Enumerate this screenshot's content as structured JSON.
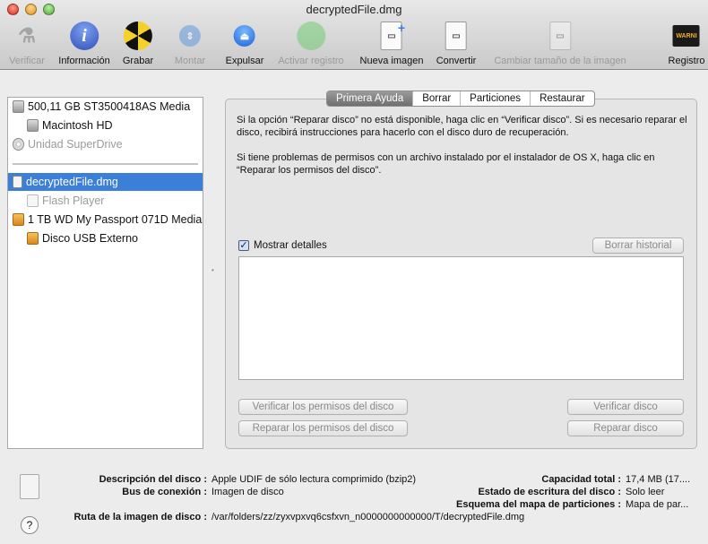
{
  "window": {
    "title": "decryptedFile.dmg"
  },
  "toolbar": [
    {
      "label": "Verificar",
      "icon": "microscope-icon",
      "enabled": false
    },
    {
      "label": "Información",
      "icon": "info-icon",
      "enabled": true
    },
    {
      "label": "Grabar",
      "icon": "burn-icon",
      "enabled": true
    },
    {
      "label": "Montar",
      "icon": "mount-icon",
      "enabled": false
    },
    {
      "label": "Expulsar",
      "icon": "eject-icon",
      "enabled": true
    },
    {
      "label": "Activar registro",
      "icon": "enable-journal-icon",
      "enabled": false
    },
    {
      "label": "Nueva imagen",
      "icon": "new-image-icon",
      "enabled": true
    },
    {
      "label": "Convertir",
      "icon": "convert-icon",
      "enabled": true
    },
    {
      "label": "Cambiar tamaño de la imagen",
      "icon": "resize-image-icon",
      "enabled": false
    },
    {
      "label": "Registro",
      "icon": "log-icon",
      "enabled": true,
      "glyph": "WARNI"
    }
  ],
  "sidebar": {
    "items": [
      {
        "label": "500,11 GB ST3500418AS Media"
      },
      {
        "label": "Macintosh HD"
      },
      {
        "label": "Unidad SuperDrive"
      },
      {
        "label": "decryptedFile.dmg"
      },
      {
        "label": "Flash Player"
      },
      {
        "label": "1 TB WD My Passport 071D Media"
      },
      {
        "label": "Disco USB Externo"
      }
    ]
  },
  "tabs": [
    "Primera Ayuda",
    "Borrar",
    "Particiones",
    "Restaurar"
  ],
  "first_aid": {
    "para1": "Si la opción “Reparar disco” no está disponible, haga clic en “Verificar disco”. Si es necesario reparar el disco, recibirá instrucciones para hacerlo con el disco duro de recuperación.",
    "para2": "Si tiene problemas de permisos con un archivo instalado por el instalador de OS X, haga clic en “Reparar los permisos del disco”.",
    "show_details": "Mostrar detalles",
    "show_details_checked": true,
    "clear_history": "Borrar historial",
    "verify_permissions": "Verificar los permisos del disco",
    "repair_permissions": "Reparar los permisos del disco",
    "verify_disk": "Verificar disco",
    "repair_disk": "Reparar disco"
  },
  "info": {
    "desc_label": "Descripción del disco :",
    "desc": "Apple UDIF de sólo lectura comprimido (bzip2)",
    "bus_label": "Bus de conexión :",
    "bus": "Imagen de disco",
    "path_label": "Ruta de la imagen de disco :",
    "path": "/var/folders/zz/zyxvpxvq6csfxvn_n0000000000000/T/decryptedFile.dmg",
    "cap_label": "Capacidad total :",
    "cap": "17,4 MB (17....",
    "write_label": "Estado de escritura del disco :",
    "write": "Solo leer",
    "scheme_label": "Esquema del mapa de particiones :",
    "scheme": "Mapa de par..."
  },
  "colors": {
    "selection": "#3b7fd8",
    "accent": "#4a70c8"
  }
}
